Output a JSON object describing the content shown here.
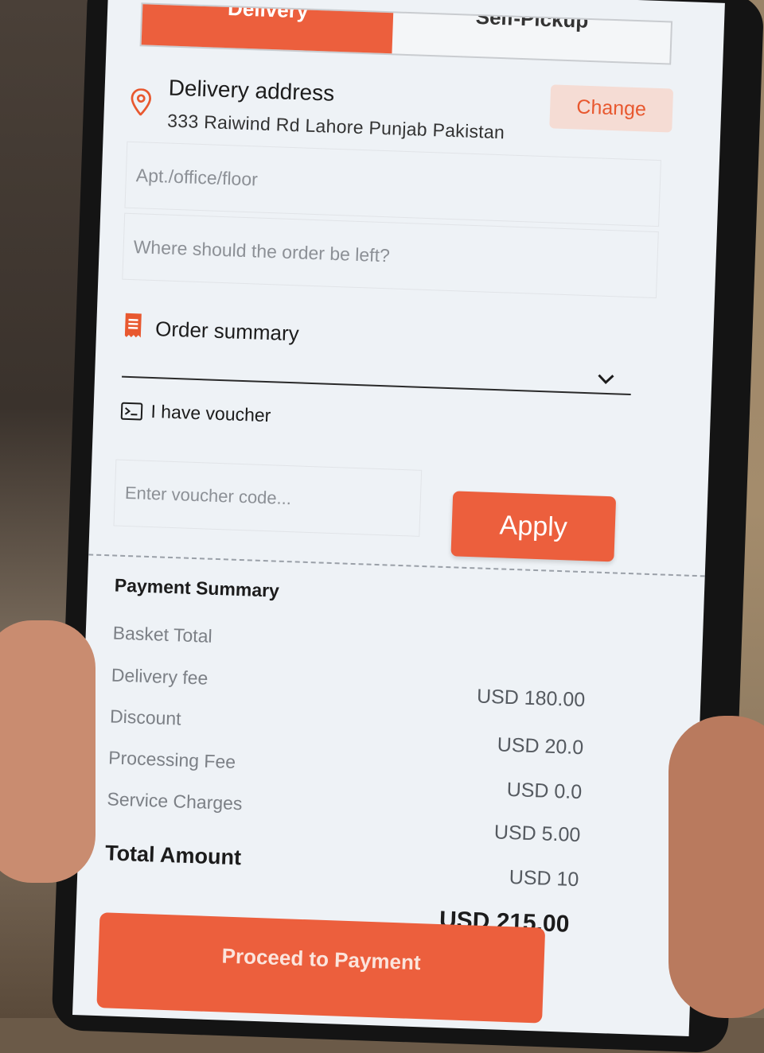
{
  "tabs": {
    "delivery": "Delivery",
    "pickup": "Self-Pickup"
  },
  "address": {
    "title": "Delivery address",
    "line": "333 Raiwind Rd Lahore Punjab Pakistan",
    "change_label": "Change"
  },
  "fields": {
    "apt_placeholder": "Apt./office/floor",
    "instructions_placeholder": "Where should the order be left?"
  },
  "order_summary": {
    "title": "Order summary"
  },
  "voucher": {
    "title": "I have voucher",
    "placeholder": "Enter voucher code...",
    "apply_label": "Apply"
  },
  "payment_summary": {
    "title": "Payment Summary",
    "rows": [
      {
        "label": "Basket Total",
        "value": "USD 180.00"
      },
      {
        "label": "Delivery fee",
        "value": "USD 20.0"
      },
      {
        "label": "Discount",
        "value": "USD 0.0"
      },
      {
        "label": "Processing Fee",
        "value": "USD 5.00"
      },
      {
        "label": "Service Charges",
        "value": "USD 10"
      }
    ],
    "total_label": "Total Amount",
    "total_value": "USD 215.00"
  },
  "proceed_label": "Proceed to Payment",
  "colors": {
    "accent": "#ec5f3d",
    "accent_soft": "#f5dcd4"
  },
  "icons": [
    "location-pin-icon",
    "receipt-icon",
    "chevron-down-icon",
    "voucher-ticket-icon"
  ]
}
